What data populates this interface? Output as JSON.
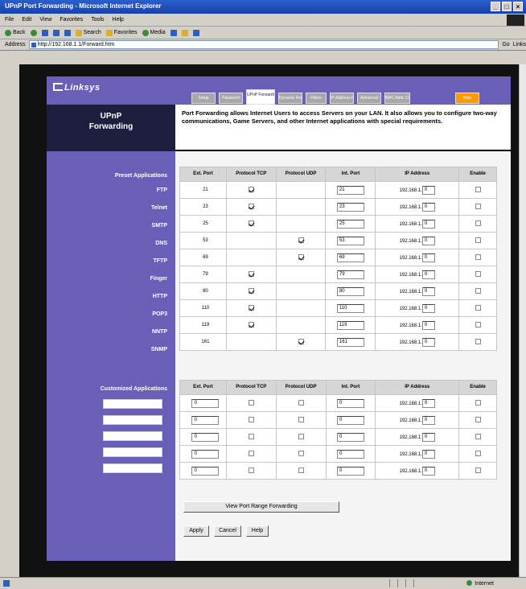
{
  "window": {
    "title": "UPnP Port Forwarding - Microsoft Internet Explorer",
    "controls": [
      "_",
      "□",
      "×"
    ]
  },
  "menu": [
    "File",
    "Edit",
    "View",
    "Favorites",
    "Tools",
    "Help"
  ],
  "toolbar": {
    "back": "Back",
    "search": "Search",
    "favorites": "Favorites",
    "media": "Media"
  },
  "address": {
    "label": "Address",
    "url": "http://192.168.1.1/Forward.htm",
    "go": "Go",
    "links": "Links"
  },
  "logo": "Linksys",
  "page_title": [
    "UPnP",
    "Forwarding"
  ],
  "tabs": [
    {
      "label": "Setup"
    },
    {
      "label": "Password"
    },
    {
      "label": "UPnP Forwarding",
      "active": true
    },
    {
      "label": "Dynamic Routing"
    },
    {
      "label": "Filters"
    },
    {
      "label": "IP-Address Filter"
    },
    {
      "label": "Advanced"
    },
    {
      "label": "MAC Addr. Clone"
    },
    {
      "label": "Help",
      "special": "help"
    }
  ],
  "description": "Port Forwarding allows Internet Users to access Servers on your LAN. It also allows you to configure two-way communications, Game Servers, and other Internet applications with special requirements.",
  "preset_label": "Preset Applications",
  "custom_label": "Customized Applications",
  "headers": [
    "Ext. Port",
    "Protocol TCP",
    "Protocol UDP",
    "Int. Port",
    "IP Address",
    "Enable"
  ],
  "ip_prefix": "192.168.1.",
  "preset": [
    {
      "app": "FTP",
      "ext": "21",
      "tcp": true,
      "udp": false,
      "int": "21",
      "ip": "0"
    },
    {
      "app": "Telnet",
      "ext": "23",
      "tcp": true,
      "udp": false,
      "int": "23",
      "ip": "0"
    },
    {
      "app": "SMTP",
      "ext": "25",
      "tcp": true,
      "udp": false,
      "int": "25",
      "ip": "0"
    },
    {
      "app": "DNS",
      "ext": "53",
      "tcp": false,
      "udp": true,
      "int": "53",
      "ip": "0"
    },
    {
      "app": "TFTP",
      "ext": "69",
      "tcp": false,
      "udp": true,
      "int": "69",
      "ip": "0"
    },
    {
      "app": "Finger",
      "ext": "79",
      "tcp": true,
      "udp": false,
      "int": "79",
      "ip": "0"
    },
    {
      "app": "HTTP",
      "ext": "80",
      "tcp": true,
      "udp": false,
      "int": "80",
      "ip": "0"
    },
    {
      "app": "POP3",
      "ext": "110",
      "tcp": true,
      "udp": false,
      "int": "110",
      "ip": "0"
    },
    {
      "app": "NNTP",
      "ext": "119",
      "tcp": true,
      "udp": false,
      "int": "119",
      "ip": "0"
    },
    {
      "app": "SNMP",
      "ext": "161",
      "tcp": false,
      "udp": true,
      "int": "161",
      "ip": "0"
    }
  ],
  "custom": [
    {
      "ext": "0",
      "int": "0",
      "ip": "0"
    },
    {
      "ext": "0",
      "int": "0",
      "ip": "0"
    },
    {
      "ext": "0",
      "int": "0",
      "ip": "0"
    },
    {
      "ext": "0",
      "int": "0",
      "ip": "0"
    },
    {
      "ext": "0",
      "int": "0",
      "ip": "0"
    }
  ],
  "buttons": {
    "range": "View Port Range Forwarding",
    "apply": "Apply",
    "cancel": "Cancel",
    "help": "Help"
  },
  "status": {
    "left": "",
    "zone": "Internet"
  }
}
